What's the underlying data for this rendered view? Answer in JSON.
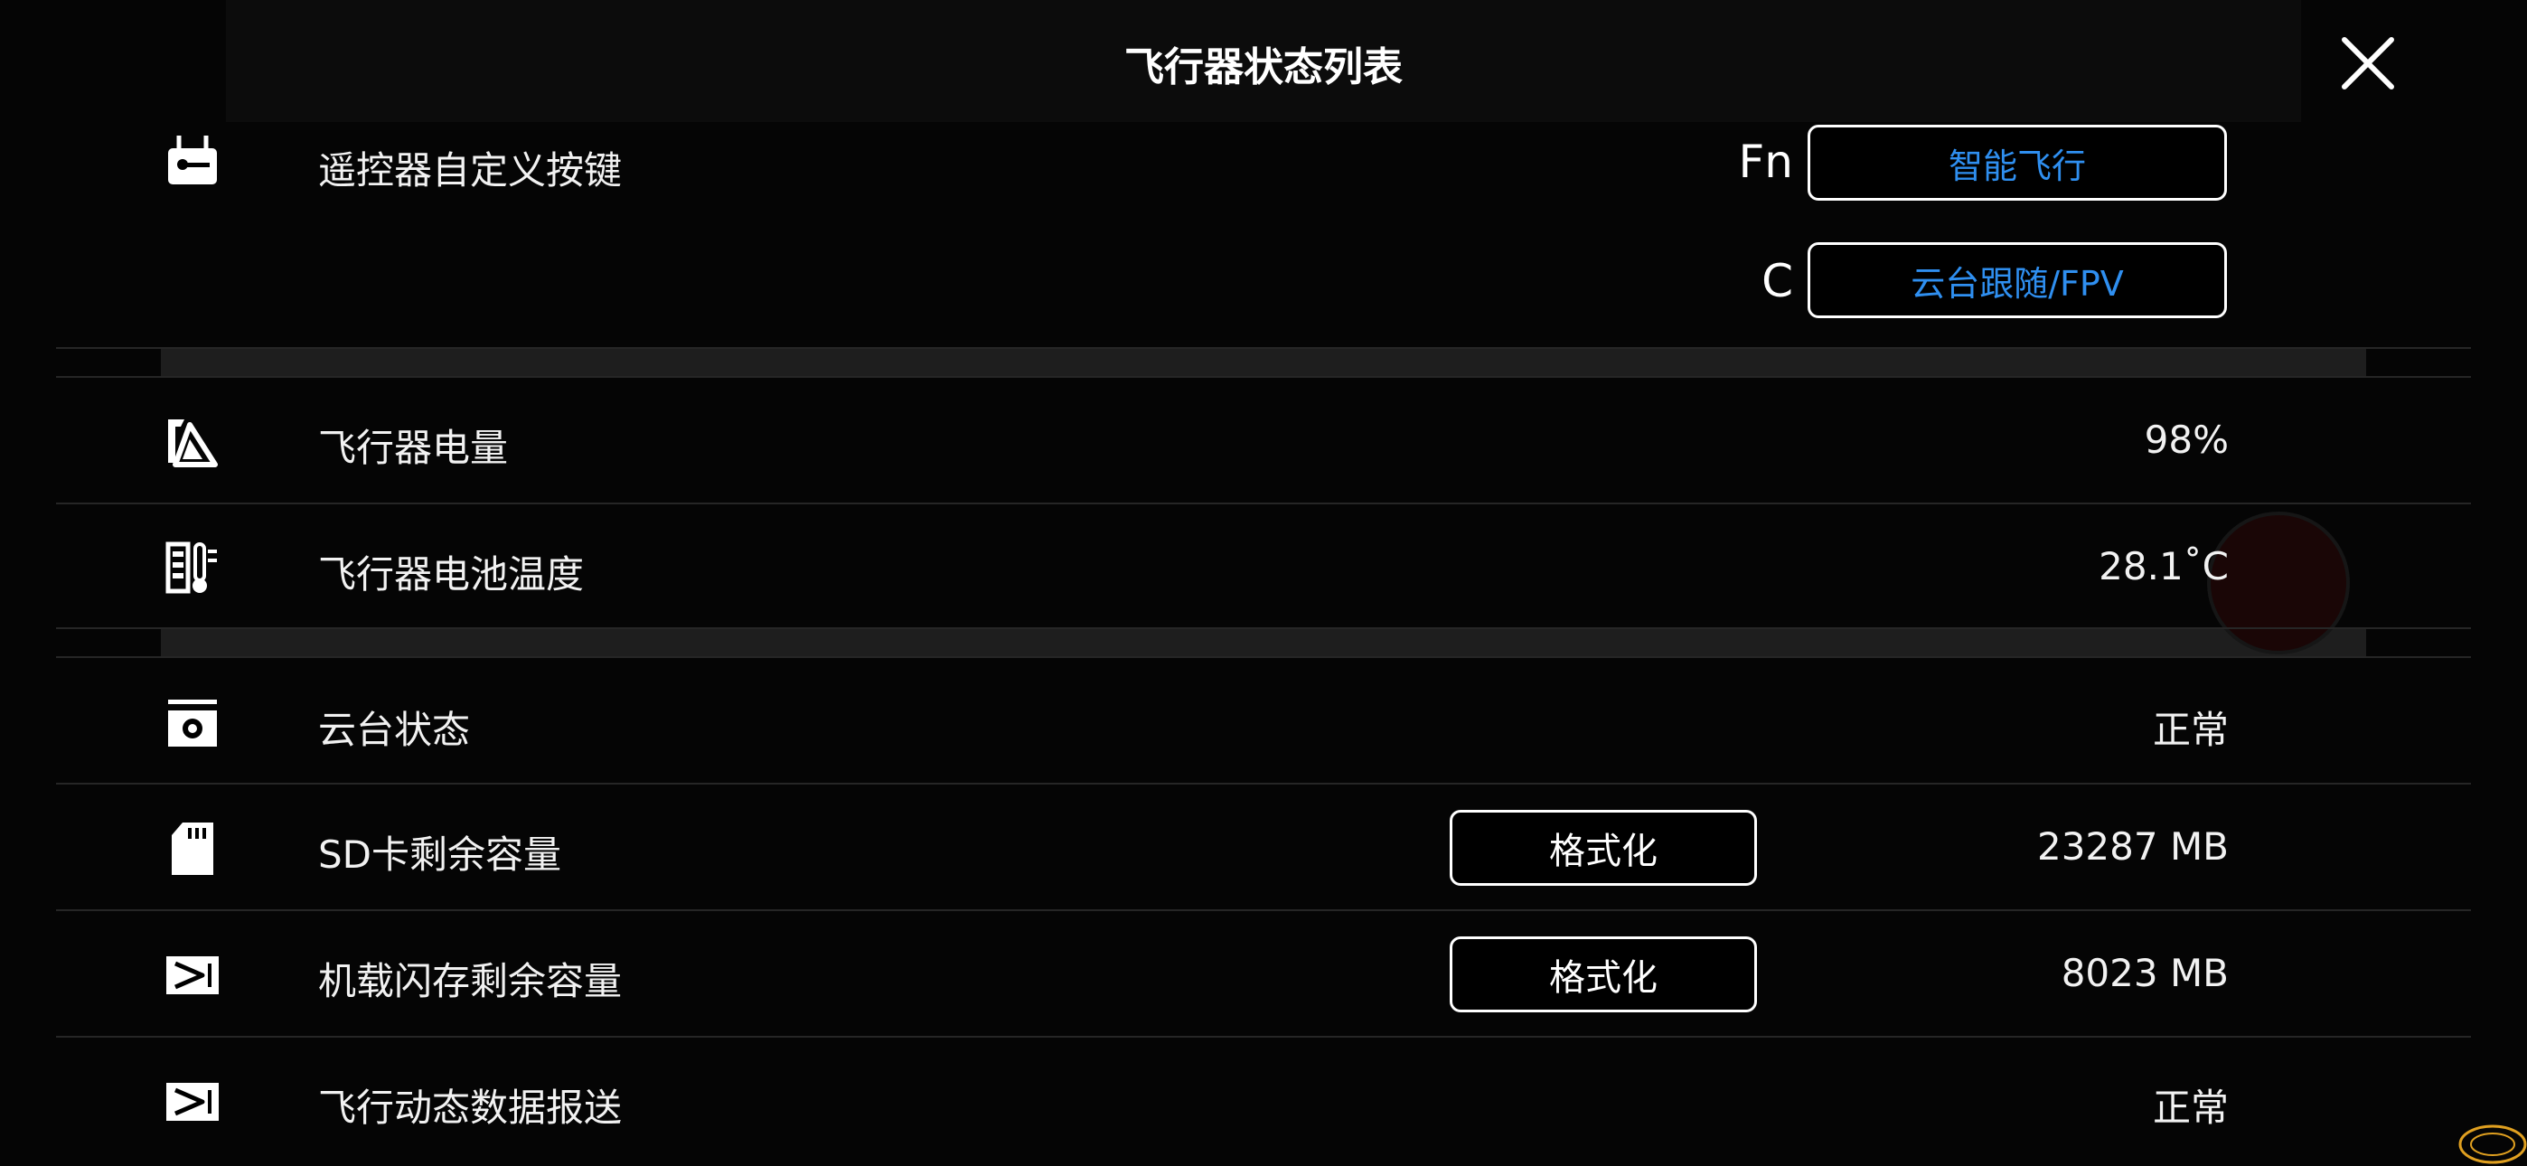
{
  "dialog": {
    "title": "飞行器状态列表"
  },
  "remote_keys": {
    "label": "遥控器自定义按键",
    "keys": [
      {
        "letter": "Fn",
        "action": "智能飞行"
      },
      {
        "letter": "C",
        "action": "云台跟随/FPV"
      }
    ]
  },
  "rows": {
    "battery": {
      "label": "飞行器电量",
      "value": "98%"
    },
    "battery_temp": {
      "label": "飞行器电池温度",
      "value": "28.1˚C"
    },
    "gimbal": {
      "label": "云台状态",
      "value": "正常"
    },
    "sd_card": {
      "label": "SD卡剩余容量",
      "button": "格式化",
      "value": "23287 MB"
    },
    "internal_storage": {
      "label": "机载闪存剩余容量",
      "button": "格式化",
      "value": "8023 MB"
    },
    "flight_data": {
      "label": "飞行动态数据报送",
      "value": "正常"
    }
  },
  "colors": {
    "accent": "#2f8ff0",
    "background": "#050505"
  }
}
